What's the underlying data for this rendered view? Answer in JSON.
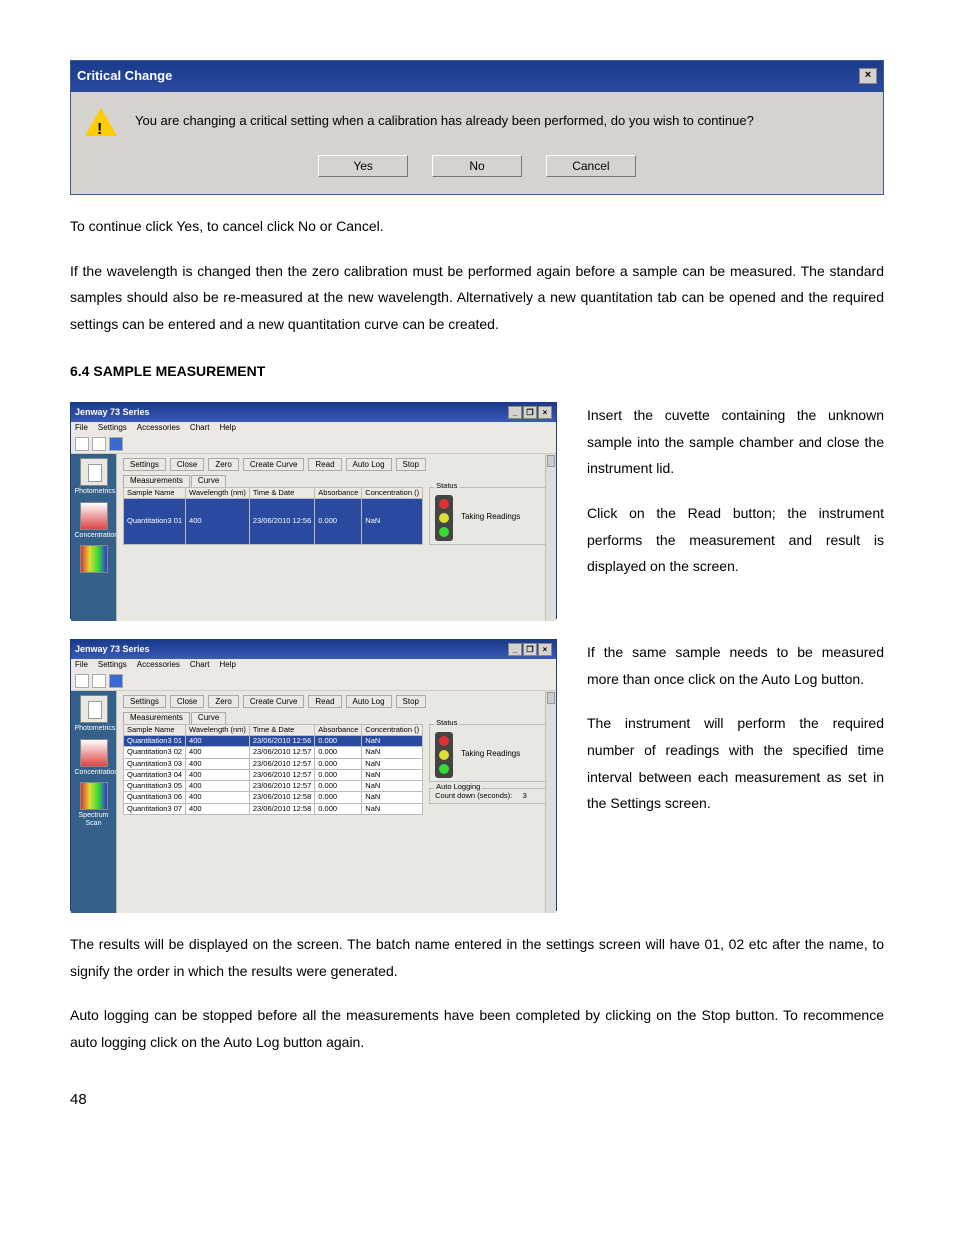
{
  "dialog": {
    "title": "Critical Change",
    "message": "You are changing a critical setting when a calibration has already been performed, do you wish to continue?",
    "yes": "Yes",
    "no": "No",
    "cancel": "Cancel"
  },
  "body": {
    "p1": "To continue click Yes, to cancel click No or Cancel.",
    "p2": "If the wavelength is changed then the zero calibration must be performed again before a sample can be measured. The standard samples should also be re-measured at the new wavelength. Alternatively a new quantitation tab can be opened and the required settings can be entered and a new quantitation curve can be created.",
    "heading": "6.4  SAMPLE MEASUREMENT",
    "r1": "Insert the cuvette containing the unknown sample into the sample chamber and close the instrument lid.",
    "r2": "Click on the Read button; the instrument performs the measurement and result is displayed on the screen.",
    "r3": "If the same sample needs to be measured more than once click on the Auto Log button.",
    "r4": "The instrument will perform the required number of readings with the specified time interval between each measurement as set in the Settings screen.",
    "p3": "The results will be displayed on the screen. The batch name entered in the settings screen will have 01, 02 etc after the name, to signify the order in which the results were generated.",
    "p4": "Auto logging can be stopped before all the measurements have been completed by clicking on the Stop button. To recommence auto logging click on the Auto Log button again."
  },
  "app": {
    "title": "Jenway 73 Series",
    "menu": {
      "file": "File",
      "settings": "Settings",
      "accessories": "Accessories",
      "chart": "Chart",
      "help": "Help"
    },
    "sidebar": {
      "photometrics": "Photometrics",
      "concentration": "Concentration",
      "spectrum": "Spectrum Scan"
    },
    "buttons": {
      "settings": "Settings",
      "close": "Close",
      "zero": "Zero",
      "create": "Create Curve",
      "read": "Read",
      "autolog": "Auto Log",
      "stop": "Stop"
    },
    "tabs": {
      "measurements": "Measurements",
      "curve": "Curve"
    },
    "columns": {
      "c1": "Sample Name",
      "c2": "Wavelength (nm)",
      "c3": "Time & Date",
      "c4": "Absorbance",
      "c5": "Concentration ()"
    },
    "status": {
      "label": "Status",
      "text": "Taking Readings"
    },
    "autolog": {
      "label": "Auto Logging",
      "countdown_label": "Count down (seconds):",
      "countdown_value": "3"
    },
    "rows1": [
      {
        "name": "Quantitation3 01",
        "wl": "400",
        "td": "23/06/2010 12:56",
        "abs": "0.000",
        "conc": "NaN"
      }
    ],
    "rows2": [
      {
        "name": "Quantitation3 01",
        "wl": "400",
        "td": "23/06/2010 12:56",
        "abs": "0.000",
        "conc": "NaN"
      },
      {
        "name": "Quantitation3 02",
        "wl": "400",
        "td": "23/06/2010 12:57",
        "abs": "0.000",
        "conc": "NaN"
      },
      {
        "name": "Quantitation3 03",
        "wl": "400",
        "td": "23/06/2010 12:57",
        "abs": "0.000",
        "conc": "NaN"
      },
      {
        "name": "Quantitation3 04",
        "wl": "400",
        "td": "23/06/2010 12:57",
        "abs": "0.000",
        "conc": "NaN"
      },
      {
        "name": "Quantitation3 05",
        "wl": "400",
        "td": "23/06/2010 12:57",
        "abs": "0.000",
        "conc": "NaN"
      },
      {
        "name": "Quantitation3 06",
        "wl": "400",
        "td": "23/06/2010 12:58",
        "abs": "0.000",
        "conc": "NaN"
      },
      {
        "name": "Quantitation3 07",
        "wl": "400",
        "td": "23/06/2010 12:58",
        "abs": "0.000",
        "conc": "NaN"
      }
    ]
  },
  "page_number": "48"
}
